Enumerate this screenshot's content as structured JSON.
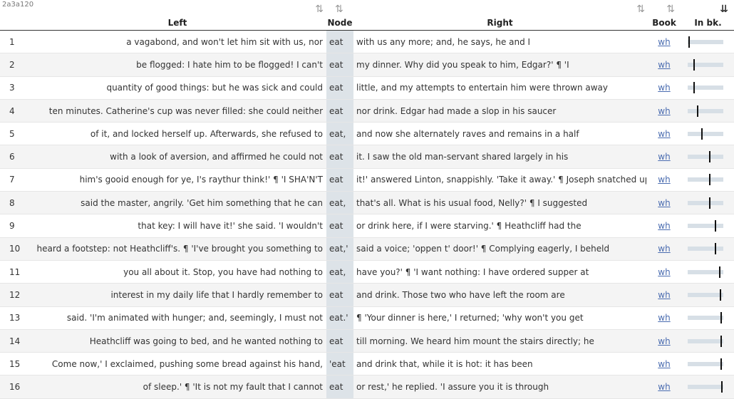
{
  "corner_id": "2a3a120",
  "headers": {
    "left": "Left",
    "node": "Node",
    "right": "Right",
    "book": "Book",
    "inbk": "In bk."
  },
  "sort_icons": {
    "left": "⇅",
    "node": "⇅",
    "right": "⇅",
    "book": "⇅",
    "inbk": "⇊"
  },
  "rows": [
    {
      "n": "1",
      "left": "a vagabond, and won't let him sit with us, nor",
      "node": "eat",
      "right": "with us any more; and, he says, he and I",
      "book": "wh",
      "pos": 0.02
    },
    {
      "n": "2",
      "left": "be flogged: I hate him to be flogged! I can't",
      "node": "eat",
      "right": "my dinner. Why did you speak to him, Edgar?' ¶ 'I",
      "book": "wh",
      "pos": 0.16
    },
    {
      "n": "3",
      "left": "quantity of good things: but he was sick and could",
      "node": "eat",
      "right": "little, and my attempts to entertain him were thrown away",
      "book": "wh",
      "pos": 0.16
    },
    {
      "n": "4",
      "left": "ten minutes. Catherine's cup was never filled: she could neither",
      "node": "eat",
      "right": "nor drink. Edgar had made a slop in his saucer",
      "book": "wh",
      "pos": 0.28
    },
    {
      "n": "5",
      "left": "of it, and locked herself up. Afterwards, she refused to",
      "node": "eat,",
      "right": "and now she alternately raves and remains in a half",
      "book": "wh",
      "pos": 0.4
    },
    {
      "n": "6",
      "left": "with a look of aversion, and affirmed he could not",
      "node": "eat",
      "right": "it. I saw the old man-servant shared largely in his",
      "book": "wh",
      "pos": 0.62
    },
    {
      "n": "7",
      "left": "him's gooid enough for ye, I's raythur think!' ¶ 'I SHA'N'T",
      "node": "eat",
      "right": "it!' answered Linton, snappishly. 'Take it away.' ¶ Joseph snatched up",
      "book": "wh",
      "pos": 0.62
    },
    {
      "n": "8",
      "left": "said the master, angrily. 'Get him something that he can",
      "node": "eat,",
      "right": "that's all. What is his usual food, Nelly?' ¶ I suggested",
      "book": "wh",
      "pos": 0.62
    },
    {
      "n": "9",
      "left": "that key: I will have it!' she said. 'I wouldn't",
      "node": "eat",
      "right": "or drink here, if I were starving.' ¶ Heathcliff had the",
      "book": "wh",
      "pos": 0.8
    },
    {
      "n": "10",
      "left": "heard a footstep: not Heathcliff's. ¶ 'I've brought you something to",
      "node": "eat,'",
      "right": "said a voice; 'oppen t' door!' ¶ Complying eagerly, I beheld",
      "book": "wh",
      "pos": 0.8
    },
    {
      "n": "11",
      "left": "you all about it. Stop, you have had nothing to",
      "node": "eat,",
      "right": "have you?' ¶ 'I want nothing: I have ordered supper at",
      "book": "wh",
      "pos": 0.92
    },
    {
      "n": "12",
      "left": "interest in my daily life that I hardly remember to",
      "node": "eat",
      "right": "and drink. Those two who have left the room are",
      "book": "wh",
      "pos": 0.94
    },
    {
      "n": "13",
      "left": "said. 'I'm animated with hunger; and, seemingly, I must not",
      "node": "eat.'",
      "right": "¶ 'Your dinner is here,' I returned; 'why won't you get",
      "book": "wh",
      "pos": 0.95
    },
    {
      "n": "14",
      "left": "Heathcliff was going to bed, and he wanted nothing to",
      "node": "eat",
      "right": "till morning. We heard him mount the stairs directly; he",
      "book": "wh",
      "pos": 0.95
    },
    {
      "n": "15",
      "left": "Come now,' I exclaimed, pushing some bread against his hand,",
      "node": "'eat",
      "right": "and drink that, while it is hot: it has been",
      "book": "wh",
      "pos": 0.96
    },
    {
      "n": "16",
      "left": "of sleep.' ¶ 'It is not my fault that I cannot",
      "node": "eat",
      "right": "or rest,' he replied. 'I assure you it is through",
      "book": "wh",
      "pos": 0.97
    }
  ]
}
